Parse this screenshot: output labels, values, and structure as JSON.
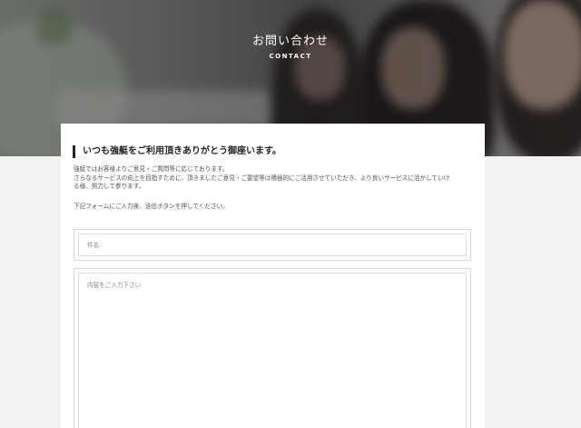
{
  "hero": {
    "title": "お問い合わせ",
    "subtitle": "CONTACT"
  },
  "intro": {
    "heading": "いつも強艇をご利用頂きありがとう御座います。",
    "lines": [
      "強艇ではお客様よりご意見・ご質問等に応じております。",
      "さらなるサービスの向上を目指すために、頂きましたご意見・ご要望等は積極的にご活用させていただき、より良いサービスに活かしていけ",
      "る様、努力して参ります。"
    ],
    "note": "下記フォームにご入力後、送信ボタンを押してください。"
  },
  "form": {
    "subject_placeholder": "件名",
    "message_placeholder": "内容をご入力下さい"
  },
  "colors": {
    "page_bg": "#f2f2f2",
    "card_bg": "#ffffff",
    "heading_bar": "#222222"
  }
}
